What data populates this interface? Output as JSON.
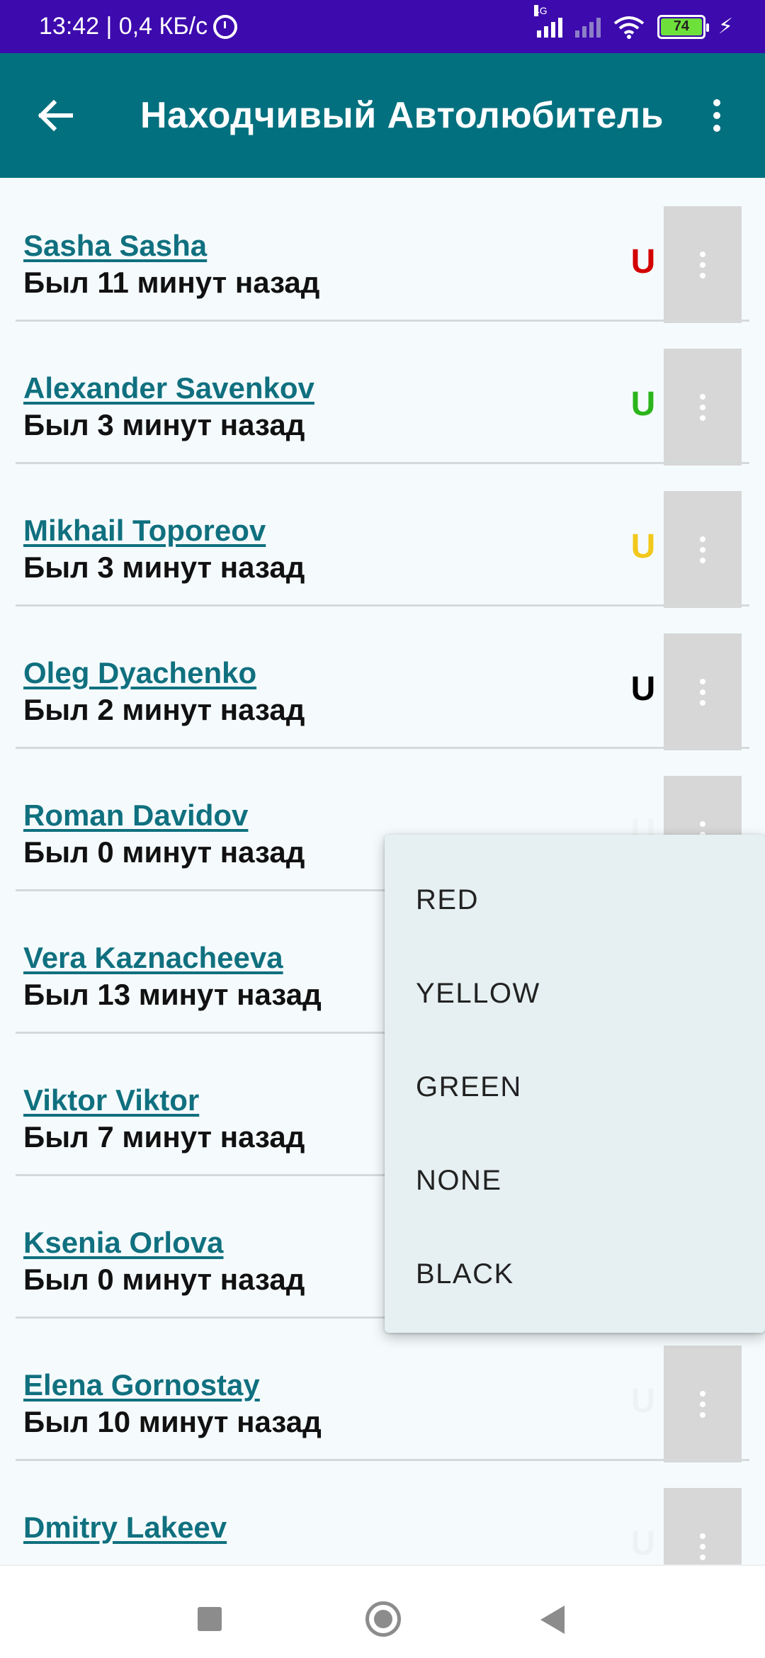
{
  "status_bar": {
    "time_speed": "13:42 | 0,4 КБ/с",
    "network_label": "4G",
    "battery_level": "74",
    "icons": [
      "alarm-icon",
      "signal-icon",
      "wifi-icon",
      "battery-icon",
      "charging-bolt-icon"
    ]
  },
  "app_bar": {
    "title": "Находчивый Автолюбитель",
    "back_icon": "arrow-back-icon",
    "overflow_icon": "more-vert-icon"
  },
  "list": {
    "items": [
      {
        "name": "Sasha Sasha",
        "status": "Был 11 минут назад",
        "flag": "U",
        "flag_color": "#d40000"
      },
      {
        "name": "Alexander Savenkov",
        "status": "Был 3 минут назад",
        "flag": "U",
        "flag_color": "#2bb51b"
      },
      {
        "name": "Mikhail Toporeov",
        "status": "Был 3 минут назад",
        "flag": "U",
        "flag_color": "#f2c81a"
      },
      {
        "name": "Oleg Dyachenko",
        "status": "Был 2 минут назад",
        "flag": "U",
        "flag_color": "#000000"
      },
      {
        "name": "Roman Davidov",
        "status": "Был 0 минут назад",
        "flag": "U",
        "flag_color": "#f0f4f5"
      },
      {
        "name": "Vera Kaznacheeva",
        "status": "Был 13 минут назад",
        "flag": "",
        "flag_color": "#f0f4f5"
      },
      {
        "name": "Viktor Viktor",
        "status": "Был 7 минут назад",
        "flag": "",
        "flag_color": "#f0f4f5"
      },
      {
        "name": "Ksenia Orlova",
        "status": "Был 0 минут назад",
        "flag": "",
        "flag_color": "#f0f4f5"
      },
      {
        "name": "Elena Gornostay",
        "status": "Был 10 минут назад",
        "flag": "U",
        "flag_color": "#eef2f3"
      },
      {
        "name": "Dmitry Lakeev",
        "status": "",
        "flag": "U",
        "flag_color": "#eef2f3"
      }
    ]
  },
  "dropdown": {
    "options": [
      "RED",
      "YELLOW",
      "GREEN",
      "NONE",
      "BLACK"
    ]
  },
  "colors": {
    "status_bar": "#3d0aad",
    "app_bar": "#03707f",
    "link": "#10707f",
    "background": "#f5fbfd"
  }
}
